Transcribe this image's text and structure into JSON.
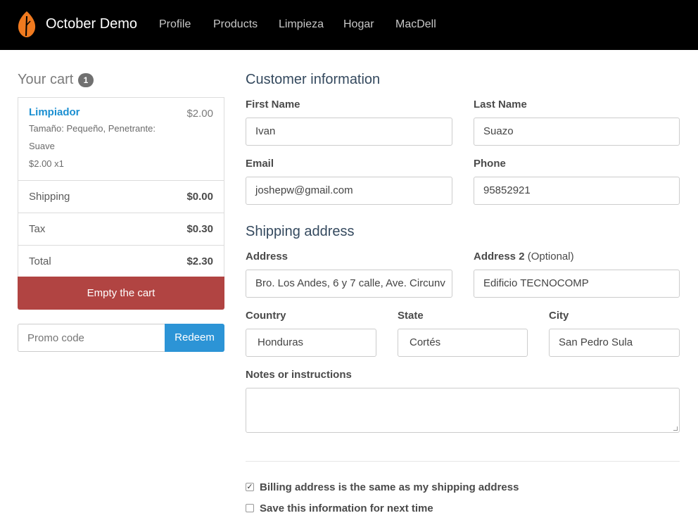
{
  "navbar": {
    "brand": "October Demo",
    "links": [
      "Profile",
      "Products",
      "Limpieza",
      "Hogar",
      "MacDell"
    ],
    "logo_color": "#f07a1f"
  },
  "cart": {
    "title": "Your cart",
    "count": "1",
    "item": {
      "name": "Limpiador",
      "price": "$2.00",
      "options_line1": "Tamaño: Pequeño, Penetrante:",
      "options_line2": "Suave",
      "qty_line": "$2.00 x1"
    },
    "shipping": {
      "label": "Shipping",
      "value": "$0.00"
    },
    "tax": {
      "label": "Tax",
      "value": "$0.30"
    },
    "total": {
      "label": "Total",
      "value": "$2.30"
    },
    "empty_button": "Empty the cart",
    "promo_placeholder": "Promo code",
    "redeem_button": "Redeem"
  },
  "customer": {
    "title": "Customer information",
    "first_name_label": "First Name",
    "first_name": "Ivan",
    "last_name_label": "Last Name",
    "last_name": "Suazo",
    "email_label": "Email",
    "email": "joshepw@gmail.com",
    "phone_label": "Phone",
    "phone": "95852921"
  },
  "shipping": {
    "title": "Shipping address",
    "address_label": "Address",
    "address": "Bro. Los Andes, 6 y 7 calle, Ave. Circunv",
    "address2_label": "Address 2",
    "address2_optional": "(Optional)",
    "address2": "Edificio TECNOCOMP",
    "country_label": "Country",
    "country": "Honduras",
    "state_label": "State",
    "state": "Cortés",
    "city_label": "City",
    "city": "San Pedro Sula",
    "notes_label": "Notes or instructions",
    "notes": ""
  },
  "options": {
    "billing_same": {
      "label": "Billing address is the same as my shipping address",
      "checked": true
    },
    "save_info": {
      "label": "Save this information for next time",
      "checked": false
    }
  },
  "colors": {
    "danger": "#b14442",
    "primary": "#2c94d6",
    "link": "#1b8fd1"
  }
}
